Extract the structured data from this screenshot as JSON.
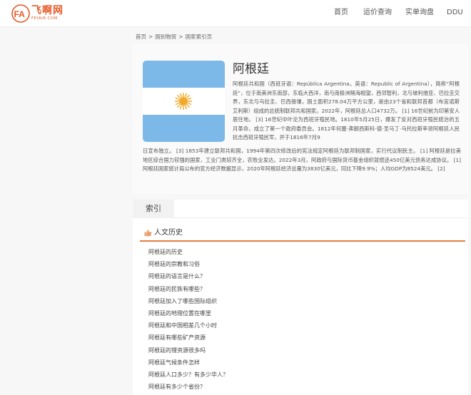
{
  "header": {
    "logo_text": "飞啊网",
    "logo_sub": "FEIAIR.COM",
    "nav": [
      "首页",
      "运价查询",
      "实单询盘",
      "DDU"
    ]
  },
  "breadcrumb": [
    "首页",
    "国别物贸",
    "国家索引页"
  ],
  "country": {
    "title": "阿根廷",
    "desc_top": "阿根廷共和国（西班牙语：República Argentina，英语：Republic of Argentina），简称“阿根廷”，位于南美洲东南部，东临大西洋，南与南极洲隔海相望，西邻智利，北与玻利维亚、巴拉圭交界，东北与乌拉圭、巴西接壤，国土面积278.04万平方公里，是由23个省和联邦首都（布宜诺斯艾利斯）组成的总统制联邦共和国家。2022年，阿根廷总人口4732万。 [1] 16世纪前为印第安人居住地。 [3] 16世纪中叶沦为西班牙殖民地。1810年5月25日，爆发了反对西班牙殖民统治的五月革命，成立了第一个政府委员会。1812年何塞·弗朗西斯科·德·圣马丁·马托拉斯率领阿根廷人民抗击西班牙殖民军，并于1816年7月9",
    "desc_bottom": "日宣布独立。 [3] 1853年建立联邦共和国，1994年第四次修改后的宪法规定阿根廷为联邦制国家，实行代议制民主。 [1] 阿根廷是拉美地区综合国力较强的国家，工业门类较齐全，农牧业发达。2022年3月，阿政府与国际货币基金组织就偿还450亿美元债务达成协议。 [1] 阿根廷国家统计局公布的官方经济数据显示，2020年阿根廷经济总量为3830亿美元，同比下降9.9%；人均GDP为8524美元。 [2]"
  },
  "index": {
    "tab_label": "索引",
    "section_title": "人文历史",
    "items": [
      "阿根廷的历史",
      "阿根廷的宗教和习俗",
      "阿根廷的语言是什么？",
      "阿根廷的民族有哪些？",
      "阿根廷加入了哪些国际组织",
      "阿根廷的地理位置在哪里",
      "阿根廷和中国相差几个小时",
      "阿根廷有哪些矿产资源",
      "阿根廷的锂资源很多吗",
      "阿根廷气候条件怎样",
      "阿根廷人口多少？有多少华人？",
      "阿根廷有多少个省份？"
    ]
  },
  "colors": {
    "brand": "#e55a29",
    "flag_blue": "#7db9e8",
    "sun": "#f0a928",
    "accent_underline": "#e57f3c"
  },
  "icons": {
    "logo": "feiair-logo-icon",
    "sun": "sun-of-may-icon",
    "section": "thumbs-up-icon"
  }
}
